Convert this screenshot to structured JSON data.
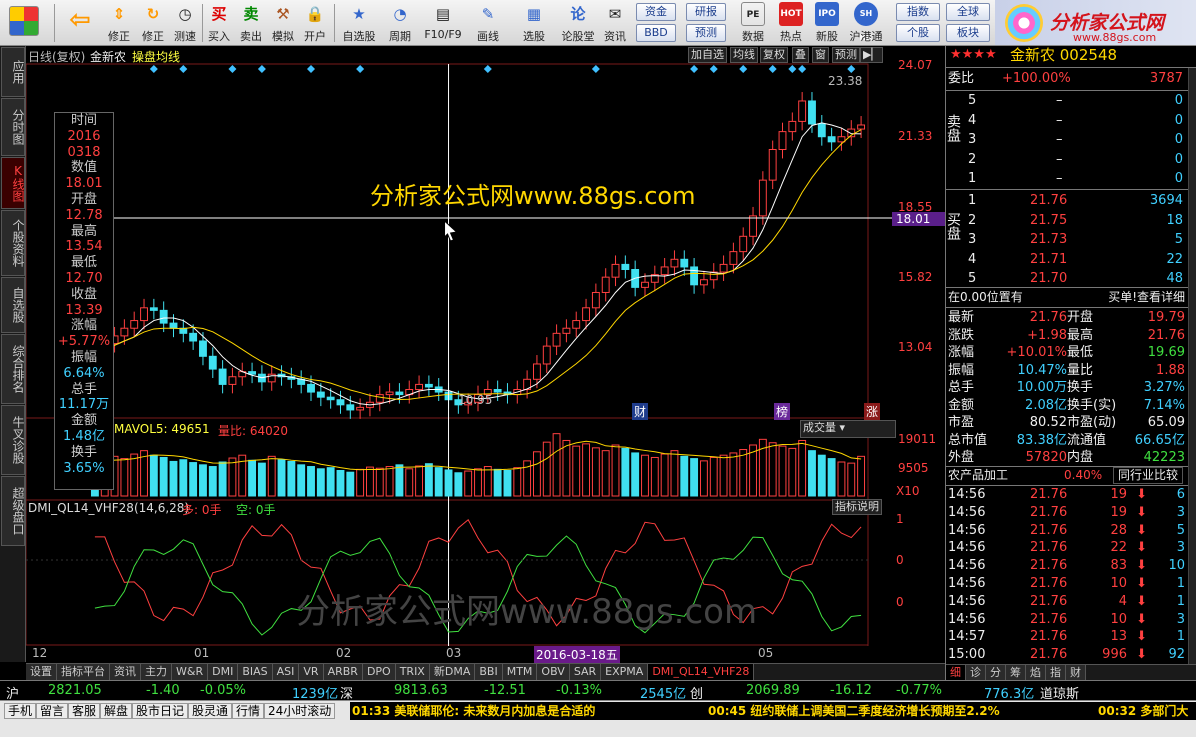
{
  "toolbar": {
    "buttons": [
      "修正",
      "测速",
      "买入",
      "卖出",
      "模拟",
      "开户",
      "自选股",
      "周期",
      "F10/F9",
      "画线",
      "选股",
      "论股堂",
      "资讯",
      "数据",
      "热点",
      "新股",
      "沪港通"
    ],
    "buy_glyph": "买",
    "sell_glyph": "卖",
    "lun_glyph": "论",
    "pills": [
      "资金",
      "研报",
      "指数",
      "全球",
      "BBD",
      "预测",
      "个股",
      "板块"
    ],
    "logo_title": "分析家公式网",
    "logo_url": "www.88gs.com"
  },
  "left_tabs": [
    "应用",
    "分时图",
    "K线图",
    "个股资料",
    "自选股",
    "综合排名",
    "牛叉诊股",
    "超级盘口"
  ],
  "chart": {
    "header": "日线(复权)",
    "name": "金新农",
    "mode": "操盘均线",
    "right_buttons": [
      "加自选",
      "均线",
      "复权",
      "叠",
      "窗",
      "预测"
    ],
    "price_levels": [
      "24.07",
      "21.33",
      "18.55",
      "15.82",
      "13.04"
    ],
    "cursor_price": "18.01",
    "high_label": "23.38",
    "low_label": "10.95",
    "watermark": "分析家公式网www.88gs.com",
    "watermark2": "分析家公式网www.88gs.com",
    "badges": [
      "财",
      "榜",
      "涨"
    ],
    "vol_header": {
      "prefix": "0",
      "ma": "MAVOL5: 49651",
      "lb": "量比: 64020"
    },
    "vol_select": "成交量",
    "vol_levels": [
      "19011",
      "9505",
      "X10"
    ],
    "ind_header": {
      "name": "DMI_QL14_VHF28(14,6,28)",
      "duo": "多: 0手",
      "kong": "空: 0手"
    },
    "ind_btn": "指标说明",
    "ind_levels": [
      "1",
      "0",
      "0"
    ],
    "xlabels": [
      "12",
      "01",
      "02",
      "03",
      "05"
    ],
    "cursor_date": "2016-03-18五"
  },
  "chart_data": {
    "type": "candlestick",
    "open": [
      12.8,
      12.7,
      13.2,
      13.5,
      13.8,
      14.1,
      14.6,
      14.5,
      14.0,
      13.8,
      13.6,
      13.3,
      12.7,
      12.2,
      11.6,
      11.9,
      12.1,
      12.0,
      11.7,
      12.0,
      11.9,
      11.8,
      11.6,
      11.3,
      11.1,
      11.0,
      10.8,
      10.6,
      10.7,
      10.9,
      11.2,
      11.3,
      11.2,
      11.4,
      11.6,
      11.5,
      11.3,
      11.0,
      10.8,
      10.9,
      11.2,
      11.4,
      11.3,
      11.2,
      11.4,
      11.8,
      12.4,
      13.1,
      13.6,
      13.8,
      14.1,
      14.6,
      15.2,
      15.8,
      16.3,
      16.1,
      15.4,
      15.6,
      15.9,
      16.2,
      16.5,
      16.2,
      15.5,
      15.7,
      16.0,
      16.3,
      16.8,
      17.4,
      18.2,
      19.6,
      20.8,
      21.5,
      21.9,
      22.7,
      21.8,
      21.3,
      21.1,
      21.3,
      21.6
    ],
    "close": [
      12.7,
      13.2,
      13.5,
      13.8,
      14.1,
      14.6,
      14.5,
      14.0,
      13.8,
      13.6,
      13.3,
      12.7,
      12.2,
      11.6,
      11.9,
      12.1,
      12.0,
      11.7,
      12.0,
      11.9,
      11.8,
      11.6,
      11.3,
      11.1,
      11.0,
      10.8,
      10.6,
      10.7,
      10.9,
      11.2,
      11.3,
      11.2,
      11.4,
      11.6,
      11.5,
      11.3,
      11.0,
      10.8,
      10.9,
      11.2,
      11.4,
      11.3,
      11.2,
      11.4,
      11.8,
      12.4,
      13.1,
      13.6,
      13.8,
      14.1,
      14.6,
      15.2,
      15.8,
      16.3,
      16.1,
      15.4,
      15.6,
      15.9,
      16.2,
      16.5,
      16.2,
      15.5,
      15.7,
      16.0,
      16.3,
      16.8,
      17.4,
      18.2,
      19.6,
      20.8,
      21.5,
      21.9,
      22.7,
      21.8,
      21.3,
      21.1,
      21.3,
      21.6,
      21.76
    ],
    "volume": [
      62,
      58,
      70,
      66,
      74,
      80,
      72,
      68,
      61,
      64,
      59,
      55,
      52,
      60,
      67,
      72,
      63,
      58,
      70,
      64,
      61,
      55,
      52,
      48,
      50,
      45,
      42,
      47,
      51,
      49,
      52,
      55,
      48,
      53,
      57,
      50,
      46,
      41,
      44,
      48,
      52,
      47,
      45,
      50,
      62,
      78,
      95,
      110,
      98,
      88,
      92,
      85,
      80,
      90,
      84,
      76,
      72,
      68,
      74,
      80,
      70,
      66,
      62,
      68,
      72,
      76,
      82,
      90,
      100,
      94,
      88,
      84,
      98,
      80,
      72,
      66,
      60,
      58,
      70
    ],
    "ylim": [
      10.95,
      24.07
    ]
  },
  "right": {
    "stock_title": "金新农 002548",
    "wei": {
      "label": "委比",
      "val": "+100.00%",
      "num": "3787"
    },
    "sell_label": "卖盘",
    "buy_label": "买盘",
    "sell": [
      {
        "n": "5",
        "p": "–",
        "v": "0"
      },
      {
        "n": "4",
        "p": "–",
        "v": "0"
      },
      {
        "n": "3",
        "p": "–",
        "v": "0"
      },
      {
        "n": "2",
        "p": "–",
        "v": "0"
      },
      {
        "n": "1",
        "p": "–",
        "v": "0"
      }
    ],
    "buy": [
      {
        "n": "1",
        "p": "21.76",
        "v": "3694"
      },
      {
        "n": "2",
        "p": "21.75",
        "v": "18"
      },
      {
        "n": "3",
        "p": "21.73",
        "v": "5"
      },
      {
        "n": "4",
        "p": "21.71",
        "v": "22"
      },
      {
        "n": "5",
        "p": "21.70",
        "v": "48"
      }
    ],
    "pos_text": "在0.00位置有",
    "pos_right": "买单!查看详细",
    "quote": [
      [
        "最新",
        "21.76",
        "开盘",
        "19.79"
      ],
      [
        "涨跌",
        "+1.98",
        "最高",
        "21.76"
      ],
      [
        "涨幅",
        "+10.01%",
        "最低",
        "19.69"
      ],
      [
        "振幅",
        "10.47%",
        "量比",
        "1.88"
      ],
      [
        "总手",
        "10.00万",
        "换手",
        "3.27%"
      ],
      [
        "金额",
        "2.08亿",
        "换手(实)",
        "7.14%"
      ],
      [
        "市盈",
        "80.52",
        "市盈(动)",
        "65.09"
      ],
      [
        "总市值",
        "83.38亿",
        "流通值",
        "66.65亿"
      ],
      [
        "外盘",
        "57820",
        "内盘",
        "42223"
      ]
    ],
    "sector": {
      "name": "农产品加工",
      "pct": "0.40%",
      "btn": "同行业比较"
    },
    "ticks": [
      [
        "14:56",
        "21.76",
        "19",
        "6"
      ],
      [
        "14:56",
        "21.76",
        "19",
        "3"
      ],
      [
        "14:56",
        "21.76",
        "28",
        "5"
      ],
      [
        "14:56",
        "21.76",
        "22",
        "3"
      ],
      [
        "14:56",
        "21.76",
        "83",
        "10"
      ],
      [
        "14:56",
        "21.76",
        "10",
        "1"
      ],
      [
        "14:56",
        "21.76",
        "4",
        "1"
      ],
      [
        "14:56",
        "21.76",
        "10",
        "3"
      ],
      [
        "14:57",
        "21.76",
        "13",
        "1"
      ],
      [
        "15:00",
        "21.76",
        "996",
        "92"
      ]
    ],
    "bottom_tabs": [
      "细",
      "诊",
      "分",
      "筹",
      "焰",
      "指",
      "财"
    ]
  },
  "status1": {
    "sh": "沪",
    "sh_idx": "2821.05",
    "sh_chg": "-1.40",
    "sh_pct": "-0.05%",
    "sh_amt": "1239亿",
    "sz": "深",
    "sz_idx": "9813.63",
    "sz_chg": "-12.51",
    "sz_pct": "-0.13%",
    "sz_amt": "2545亿",
    "cy": "创",
    "cy_idx": "2069.89",
    "cy_chg": "-16.12",
    "cy_pct": "-0.77%",
    "cy_amt": "776.3亿",
    "dj": "道琼斯"
  },
  "status2": {
    "buttons": [
      "手机",
      "留言",
      "客服",
      "解盘",
      "股市日记",
      "股灵通",
      "行情",
      "24小时滚动"
    ],
    "news": [
      "01:33 美联储耶伦: 未来数月内加息是合适的",
      "00:45 纽约联储上调美国二季度经济增长预期至2.2%",
      "00:32 多部门大"
    ]
  },
  "bottom_tabs": [
    "设置",
    "指标平台",
    "资讯",
    "主力",
    "W&R",
    "DMI",
    "BIAS",
    "ASI",
    "VR",
    "ARBR",
    "DPO",
    "TRIX",
    "新DMA",
    "BBI",
    "MTM",
    "OBV",
    "SAR",
    "EXPMA",
    "DMI_QL14_VHF28"
  ],
  "infobox": [
    [
      "时间",
      "2016"
    ],
    [
      "",
      "0318"
    ],
    [
      "数值",
      "18.01"
    ],
    [
      "开盘",
      "12.78"
    ],
    [
      "最高",
      "13.54"
    ],
    [
      "最低",
      "12.70"
    ],
    [
      "收盘",
      "13.39"
    ],
    [
      "涨幅",
      "+5.77%"
    ],
    [
      "振幅",
      "6.64%"
    ],
    [
      "总手",
      "11.17万"
    ],
    [
      "金额",
      "1.48亿"
    ],
    [
      "换手",
      "3.65%"
    ]
  ],
  "colors": {
    "up": "#ff4040",
    "down": "#40e0f0",
    "bg": "#000000",
    "ma_white": "#ffffff",
    "ma_yellow": "#ffd700"
  }
}
